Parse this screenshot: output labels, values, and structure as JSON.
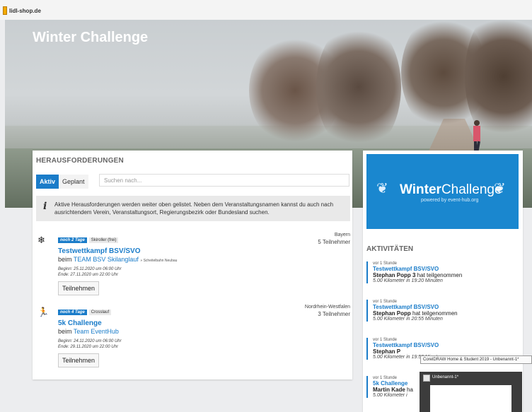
{
  "browser": {
    "tab_title": "lidl-shop.de"
  },
  "hero": {
    "title": "Winter Challenge"
  },
  "challenges": {
    "heading": "HERAUSFORDERUNGEN",
    "tabs": [
      {
        "label": "Aktiv",
        "active": true
      },
      {
        "label": "Geplant",
        "active": false
      }
    ],
    "search_placeholder": "Suchen nach...",
    "info_icon": "info-icon",
    "info_text": "Aktive Herausforderungen werden weiter oben gelistet. Neben dem Veranstaltungsnamen kannst du auch nach ausrichtendem Verein, Veranstaltungsort, Regierungsbezirk oder Bundesland suchen.",
    "entries": [
      {
        "icon": "snowflake-icon",
        "badge": "noch 2 Tage",
        "tag": "Skiroller (frei)",
        "name": "Testwettkampf BSV/SVO",
        "beim": "beim",
        "team": "TEAM BSV Skilanglauf",
        "location": "» Scheitelbahn Neubau",
        "begin": "Beginn: 25.11.2020 um 06:00 Uhr",
        "end": "Ende: 27.11.2020 um 22:00 Uhr",
        "region": "Bayern",
        "participants": "5 Teilnehmer",
        "button": "Teilnehmen"
      },
      {
        "icon": "runner-icon",
        "badge": "noch 4 Tage",
        "tag": "Crosslauf",
        "name": "5k Challenge",
        "beim": "beim",
        "team": "Team EventHub",
        "location": "",
        "begin": "Beginn: 24.11.2020 um 06:00 Uhr",
        "end": "Ende: 29.11.2020 um 22:00 Uhr",
        "region": "Nordrhein-Westfalen",
        "participants": "3 Teilnehmer",
        "button": "Teilnehmen"
      }
    ]
  },
  "sidebar": {
    "banner": {
      "title_bold": "Winter",
      "title_rest": "Challenge",
      "powered": "powered by event-hub.org"
    },
    "activities_heading": "AKTIVITÄTEN",
    "activities": [
      {
        "when": "vor 1 Stunde",
        "event": "Testwettkampf BSV/SVO",
        "person": "Stephan Popp 3",
        "action": " hat teilgenommen",
        "result": "5.00 Kilometer in 19:20 Minuten"
      },
      {
        "when": "vor 1 Stunde",
        "event": "Testwettkampf BSV/SVO",
        "person": "Stephan Popp",
        "action": " hat teilgenommen",
        "result": "5.00 Kilometer in 20:55 Minuten"
      },
      {
        "when": "vor 1 Stunde",
        "event": "Testwettkampf BSV/SVO",
        "person": "Stephan P",
        "action": "",
        "result": "5.00 Kilometer in 19:50 Minuten"
      },
      {
        "when": "vor 1 Stunde",
        "event": "5k Challenge",
        "person": "Martin Kade",
        "action": " ha",
        "result": "5.00 Kilometer i"
      }
    ]
  },
  "overlay": {
    "tooltip": "CorelDRAW Home & Student 2019 - Unbenannt-1*",
    "preview_title": "Unbenannt-1*"
  }
}
